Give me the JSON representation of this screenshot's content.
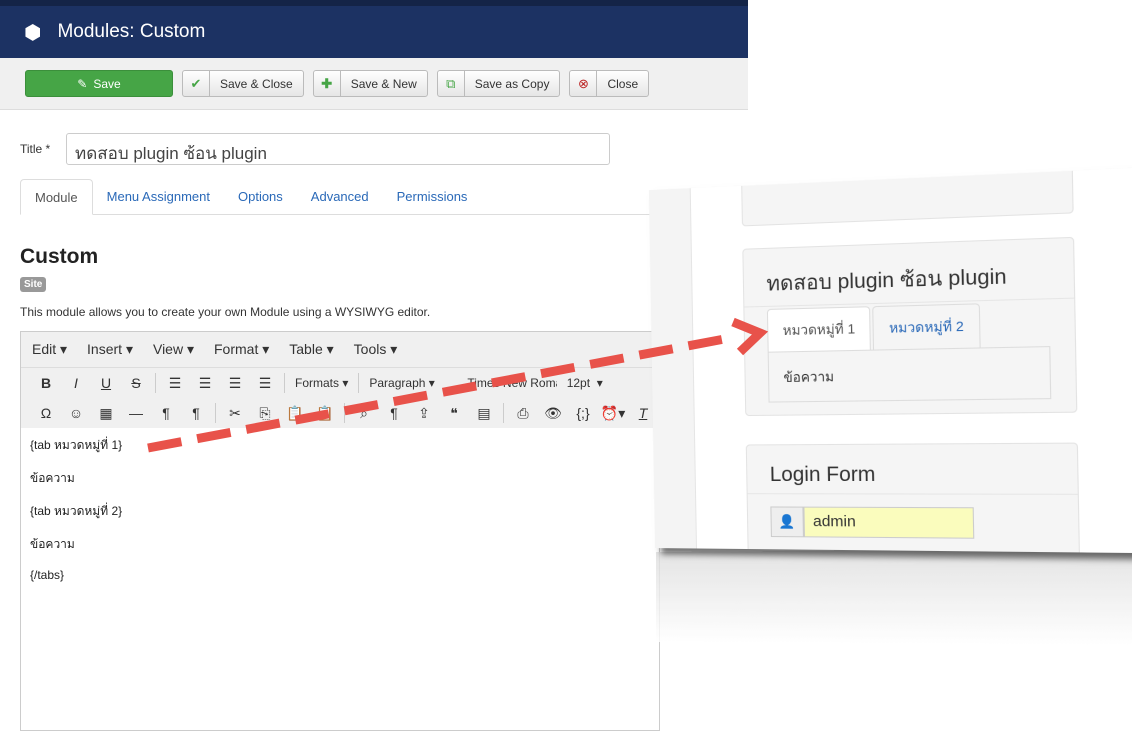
{
  "header": {
    "title": "Modules: Custom",
    "icon": "cube-icon"
  },
  "toolbar": {
    "save": "Save",
    "save_close": "Save & Close",
    "save_new": "Save & New",
    "save_copy": "Save as Copy",
    "close": "Close"
  },
  "form": {
    "title_label": "Title *",
    "title_value": "ทดสอบ plugin ซ้อน plugin"
  },
  "tabs": [
    "Module",
    "Menu Assignment",
    "Options",
    "Advanced",
    "Permissions"
  ],
  "module": {
    "heading": "Custom",
    "badge": "Site",
    "description": "This module allows you to create your own Module using a WYSIWYG editor."
  },
  "editor": {
    "menus": [
      "Edit",
      "Insert",
      "View",
      "Format",
      "Table",
      "Tools"
    ],
    "formats": "Formats",
    "block": "Paragraph",
    "font": "Times New Roman",
    "size": "12pt",
    "content": [
      "{tab หมวดหมู่ที่ 1}",
      "ข้อความ",
      "{tab หมวดหมู่ที่ 2}",
      "ข้อความ",
      "{/tabs}"
    ]
  },
  "preview": {
    "module_title": "ทดสอบ plugin ซ้อน plugin",
    "tabs": [
      "หมวดหมู่ที่ 1",
      "หมวดหมู่ที่ 2"
    ],
    "pane_text": "ข้อความ",
    "login_title": "Login Form",
    "username": "admin"
  },
  "colors": {
    "header": "#1c3263",
    "save": "#46a546",
    "arrow": "#e8524a",
    "link": "#2a69b8"
  }
}
